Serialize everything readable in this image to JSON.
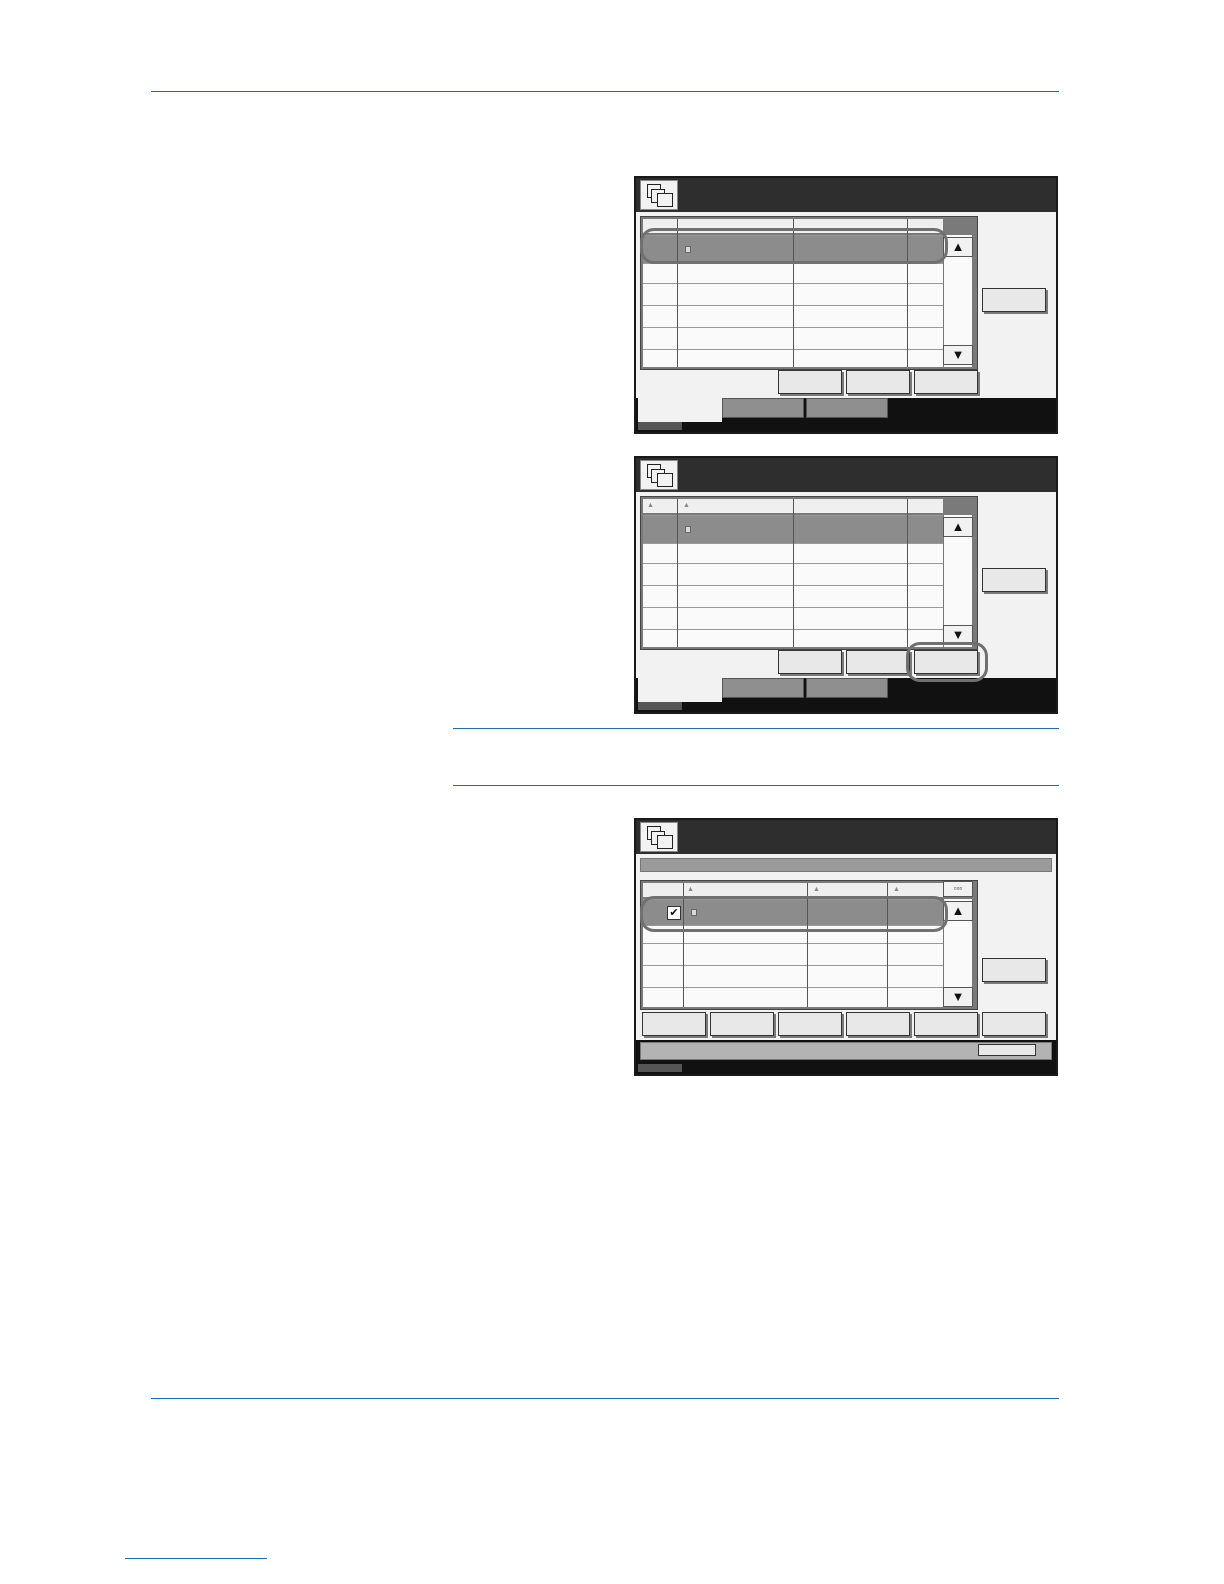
{
  "page": {
    "header_text": "",
    "footer_text": ""
  },
  "screens": [
    {
      "name": "document-box-list",
      "highlight": "first-row"
    },
    {
      "name": "document-box-list-open",
      "highlight": "right-bottom-button"
    },
    {
      "name": "document-list-selected",
      "highlight": "checked-row"
    }
  ],
  "icons": {
    "box_icon": "stacked-folders-icon",
    "scroll_up": "▲",
    "scroll_down": "▼",
    "check": "✔"
  },
  "colors": {
    "rule": "#1a6fae",
    "titlebar": "#2e2e2e",
    "selected_row": "#8c8c8c",
    "highlight_ring": "#707070"
  }
}
